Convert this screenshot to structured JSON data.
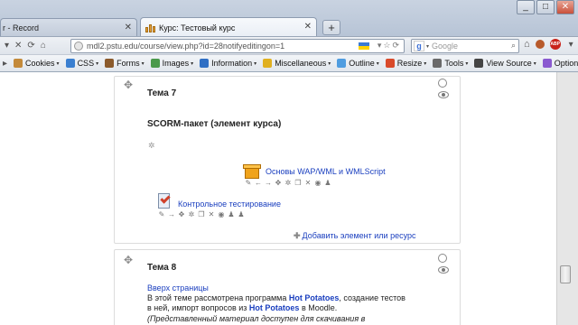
{
  "browser": {
    "tabs": [
      {
        "label": "r - Record"
      },
      {
        "label": "Курс: Тестовый курс"
      }
    ],
    "new_tab": "+",
    "window_buttons": [
      "_",
      "□",
      "✕"
    ],
    "url": "mdl2.pstu.edu/course/view.php?id=28notifyeditingon=1",
    "search_placeholder": "Google",
    "abp": "ABP"
  },
  "devbar": {
    "items": [
      {
        "label": "Cookies",
        "color": "#c48a3a"
      },
      {
        "label": "CSS",
        "color": "#3a7fd0"
      },
      {
        "label": "Forms",
        "color": "#8b5a2b"
      },
      {
        "label": "Images",
        "color": "#4b9a4b"
      },
      {
        "label": "Information",
        "color": "#2f6fc4"
      },
      {
        "label": "Miscellaneous",
        "color": "#e0b020"
      },
      {
        "label": "Outline",
        "color": "#4f9de0"
      },
      {
        "label": "Resize",
        "color": "#d94a2a"
      },
      {
        "label": "Tools",
        "color": "#6a6a6a"
      },
      {
        "label": "View Source",
        "color": "#444444"
      },
      {
        "label": "Options",
        "color": "#8a5ad0"
      }
    ]
  },
  "section7": {
    "title": "Тема 7",
    "heading": "SCORM-пакет (элемент курса)",
    "activities": [
      {
        "name": "Основы WAP/WML и WMLScript"
      },
      {
        "name": "Контрольное тестирование"
      }
    ],
    "add_label": "Добавить элемент или ресурс"
  },
  "section8": {
    "title": "Тема 8",
    "top_link": "Вверх страницы",
    "text_1a": "В этой теме рассмотрена программа ",
    "hp1": "Hot Potatoes",
    "text_1b": ", создание тестов",
    "text_2a": "в ней, импорт вопросов из ",
    "hp2": "Hot Potatoes",
    "text_2b": " в Moodle.",
    "text_3": "(Представленный материал доступен для скачивания в"
  }
}
